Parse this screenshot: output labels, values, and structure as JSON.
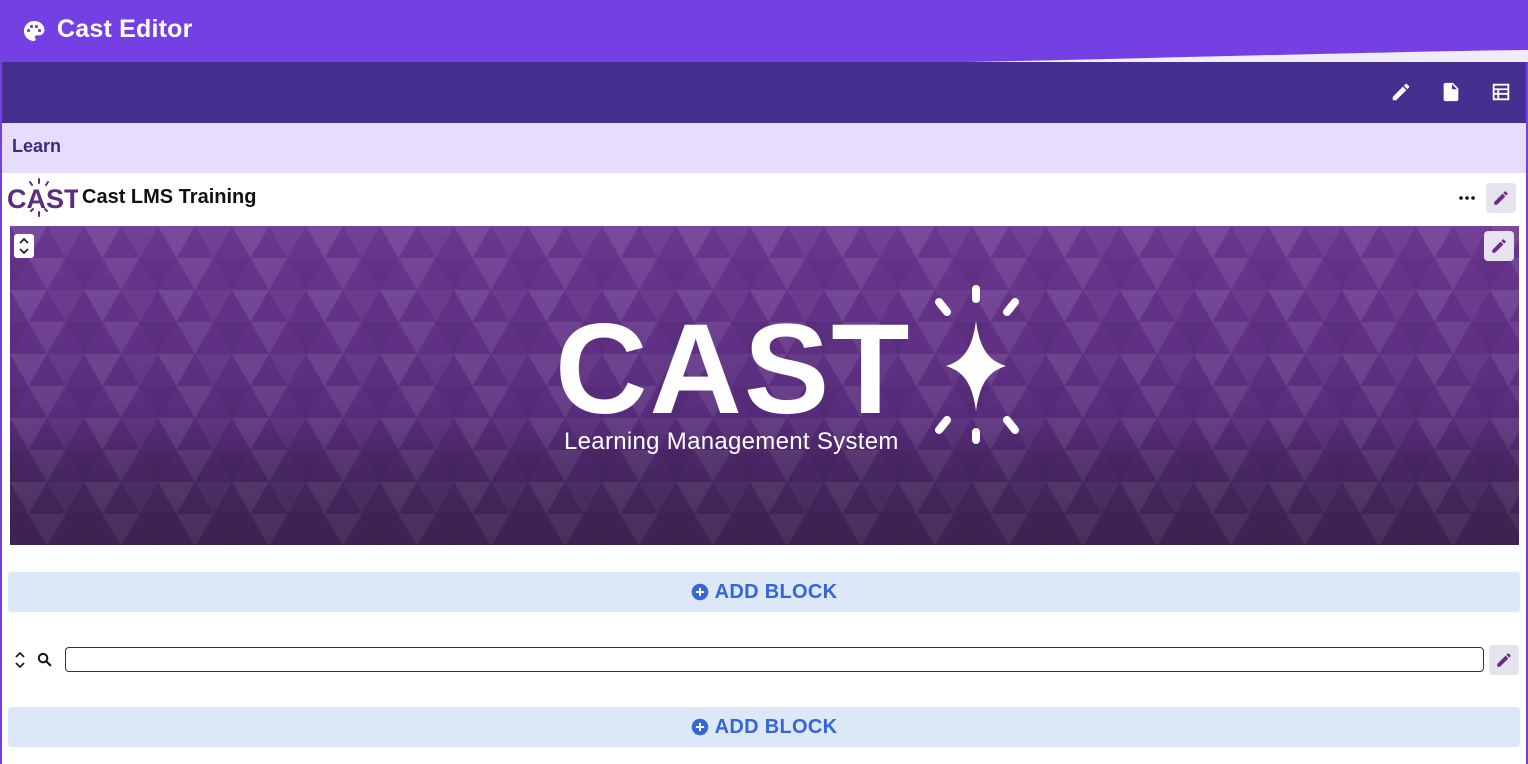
{
  "app": {
    "title": "Cast Editor",
    "icon": "palette-icon"
  },
  "toolbar": {
    "buttons": [
      "pencil-icon",
      "document-icon",
      "table-icon"
    ]
  },
  "breadcrumb": {
    "label": "Learn"
  },
  "course": {
    "title": "Cast LMS Training",
    "logo_text": "CAST"
  },
  "banner": {
    "logo_text": "CAST",
    "subtitle": "Learning Management System"
  },
  "blocks": {
    "add_block_label": "ADD BLOCK"
  },
  "search": {
    "value": ""
  },
  "colors": {
    "brand": "#7440e3",
    "toolbar": "#46308f",
    "breadcrumb_bg": "#e6dcfb",
    "banner": "#5b2d86",
    "add_block_bg": "#dce7f8",
    "add_block_text": "#3566d6"
  }
}
